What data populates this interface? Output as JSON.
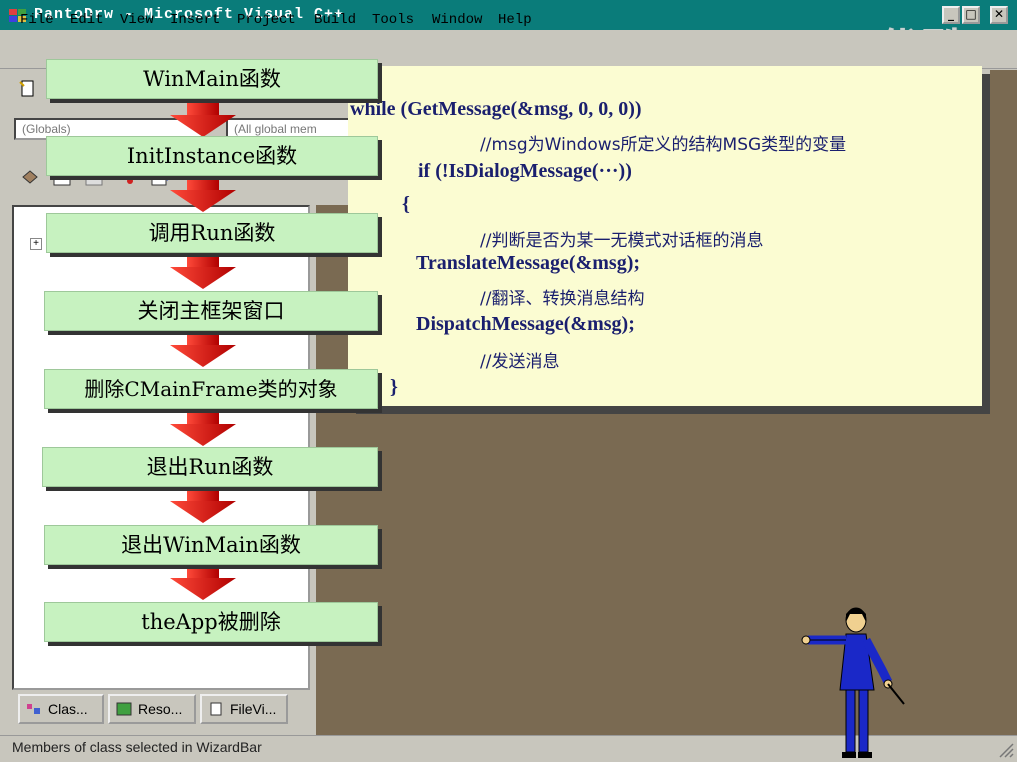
{
  "window": {
    "title": "PantoDrw - Microsoft Visual C++",
    "buttons": [
      "_",
      "□",
      "✕"
    ]
  },
  "watermark": "优酷",
  "menu": [
    "File",
    "Edit",
    "View",
    "Insert",
    "Project",
    "Build",
    "Tools",
    "Window",
    "Help"
  ],
  "toolbar": {
    "combo_globals": "(Globals)",
    "combo_members": "(All global mem"
  },
  "flow_steps": [
    "WinMain函数",
    "InitInstance函数",
    "调用Run函数",
    "关闭主框架窗口",
    "删除CMainFrame类的对象",
    "退出Run函数",
    "退出WinMain函数",
    "theApp被删除"
  ],
  "code": {
    "l1": "while (GetMessage(&msg, 0, 0, 0))",
    "l2": "//msg为Windows所定义的结构MSG类型的变量",
    "l3": "if (!IsDialogMessage(···))",
    "l4": "{",
    "l5": "//判断是否为某一无模式对话框的消息",
    "l6": "TranslateMessage(&msg);",
    "l7": "//翻译、转换消息结构",
    "l8": "DispatchMessage(&msg);",
    "l9": "//发送消息",
    "l10": "}"
  },
  "tree": {
    "expander": "+"
  },
  "workspace_tabs": [
    "Clas...",
    "Reso...",
    "FileVi..."
  ],
  "status": "Members of class selected in WizardBar",
  "colors": {
    "titlebar": "#0a7c7a",
    "flow_box": "#c7f2c0",
    "arrow": "#e01010",
    "code_bg": "#fbfcd2",
    "code_text": "#1a1f6e",
    "editor_bg": "#7a6a52"
  }
}
